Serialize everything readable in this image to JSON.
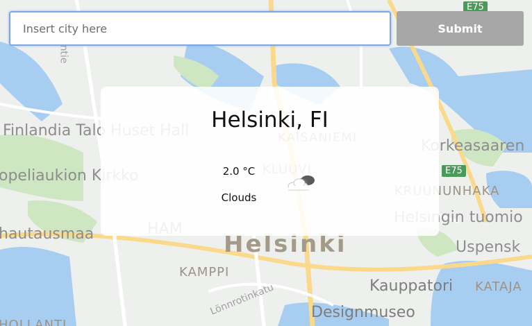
{
  "search": {
    "placeholder": "Insert city here",
    "value": ""
  },
  "submit_label": "Submit",
  "weather": {
    "location": "Helsinki, FI",
    "temperature": "2.0 °C",
    "condition": "Clouds",
    "icon": "cloudy-icon"
  },
  "map": {
    "labels": {
      "finlandia": "Finlandia Talo Huset Hall",
      "kirkko": "opeliaukion Kirkko",
      "hautausmaa": "hautausmaa",
      "ham": "HAM",
      "helsinki": "Helsinki",
      "kamppi": "KAMPPI",
      "lonnrotinkatu": "Lönnrotinkatu",
      "designmuseo": "Designmuseo",
      "kauppatori": "Kauppatori",
      "kataja": "KATAJA",
      "uspensk": "Uspensk",
      "tuomio": "Helsingin tuomio",
      "kruununhaka": "KRUUNUNHAKA",
      "korkeasaari": "Korkeasaaren",
      "kluuvi": "KLUUVI",
      "kaisaniemi": "KAISANIEMI",
      "hollanti": "HOLLANTI",
      "mannerheimintie": "ntie",
      "e75_top": "E75",
      "e75_mid": "E75"
    }
  },
  "colors": {
    "water": "#a7cef0",
    "land": "#eef0ee",
    "park": "#cfe6c3",
    "road": "#fbd98c",
    "button_bg": "#a7a7a7",
    "input_border": "#7ea7e8"
  }
}
